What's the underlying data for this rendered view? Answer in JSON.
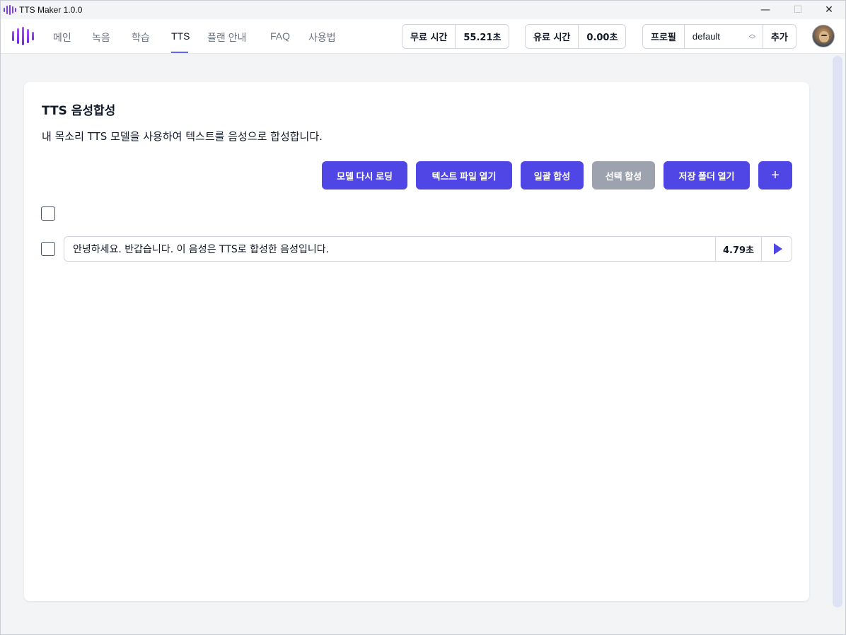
{
  "window": {
    "title": "TTS Maker 1.0.0",
    "controls": {
      "minimize": "—",
      "maximize": "☐",
      "close": "✕"
    }
  },
  "nav": {
    "items": [
      {
        "label": "메인"
      },
      {
        "label": "녹음"
      },
      {
        "label": "학습"
      },
      {
        "label": "TTS"
      },
      {
        "label": "플랜 안내"
      },
      {
        "label": "FAQ"
      },
      {
        "label": "사용법"
      }
    ],
    "active": "TTS"
  },
  "stats": {
    "free_label": "무료 시간",
    "free_value": "55.21초",
    "paid_label": "유료 시간",
    "paid_value": "0.00초"
  },
  "profile": {
    "label": "프로필",
    "selected": "default",
    "add_label": "추가"
  },
  "page": {
    "title": "TTS 음성합성",
    "description": "내 목소리 TTS 모델을 사용하여 텍스트를 음성으로 합성합니다."
  },
  "toolbar": {
    "reload_model": "모델 다시 로딩",
    "open_text_file": "텍스트 파일 열기",
    "batch_synth": "일괄 합성",
    "selected_synth": "선택 합성",
    "open_save_folder": "저장 폴더 열기",
    "add": "+"
  },
  "rows": [
    {
      "text": "안녕하세요. 반갑습니다. 이 음성은 TTS로 합성한 음성입니다.",
      "duration": "4.79초",
      "checked": false
    }
  ],
  "colors": {
    "accent": "#4f46e5",
    "disabled": "#9ca3af",
    "background": "#f3f4f6"
  },
  "icons": {
    "app_logo": "sound-wave-icon",
    "play": "play-icon",
    "select": "chevron-updown-icon"
  }
}
